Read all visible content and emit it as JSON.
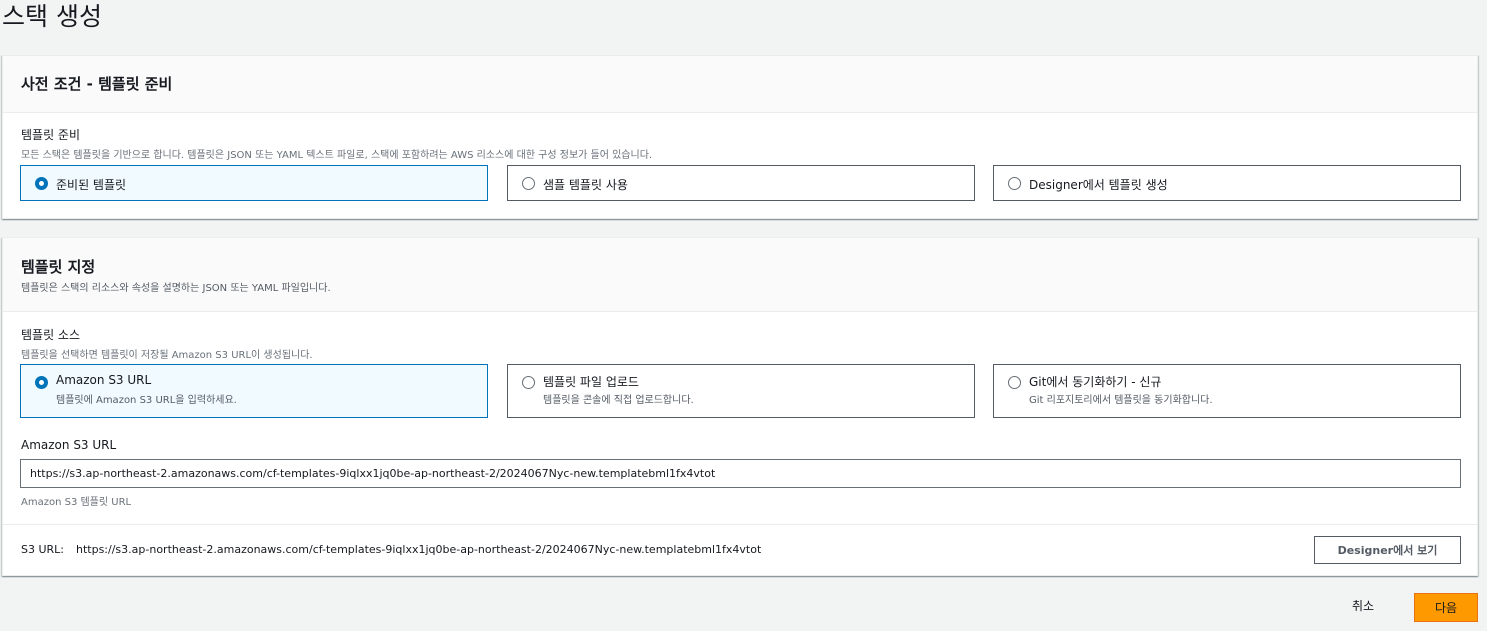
{
  "page": {
    "title": "스택 생성"
  },
  "prerequisite": {
    "heading": "사전 조건 - 템플릿 준비",
    "field_label": "템플릿 준비",
    "field_desc": "모든 스택은 템플릿을 기반으로 합니다. 템플릿은 JSON 또는 YAML 텍스트 파일로, 스택에 포함하려는 AWS 리소스에 대한 구성 정보가 들어 있습니다.",
    "options": [
      {
        "label": "준비된 템플릿",
        "selected": true
      },
      {
        "label": "샘플 템플릿 사용",
        "selected": false
      },
      {
        "label": "Designer에서 템플릿 생성",
        "selected": false
      }
    ]
  },
  "specify": {
    "heading": "템플릿 지정",
    "desc": "템플릿은 스택의 리소스와 속성을 설명하는 JSON 또는 YAML 파일입니다.",
    "source_label": "템플릿 소스",
    "source_desc": "템플릿을 선택하면 템플릿이 저장될 Amazon S3 URL이 생성됩니다.",
    "sources": [
      {
        "label": "Amazon S3 URL",
        "desc": "템플릿에 Amazon S3 URL을 입력하세요.",
        "selected": true
      },
      {
        "label": "템플릿 파일 업로드",
        "desc": "템플릿을 콘솔에 직접 업로드합니다.",
        "selected": false
      },
      {
        "label": "Git에서 동기화하기 - 신규",
        "desc": "Git 리포지토리에서 템플릿을 동기화합니다.",
        "selected": false
      }
    ],
    "url_label": "Amazon S3 URL",
    "url_value": "https://s3.ap-northeast-2.amazonaws.com/cf-templates-9iqlxx1jq0be-ap-northeast-2/2024067Nyc-new.templatebml1fx4vtot",
    "url_hint": "Amazon S3 템플릿 URL",
    "s3_label": "S3 URL:",
    "s3_value": "https://s3.ap-northeast-2.amazonaws.com/cf-templates-9iqlxx1jq0be-ap-northeast-2/2024067Nyc-new.templatebml1fx4vtot",
    "designer_button": "Designer에서 보기"
  },
  "footer": {
    "cancel": "취소",
    "next": "다음"
  },
  "colors": {
    "accent": "#0073bb",
    "primary_button": "#ff9900",
    "background": "#f2f3f3"
  }
}
